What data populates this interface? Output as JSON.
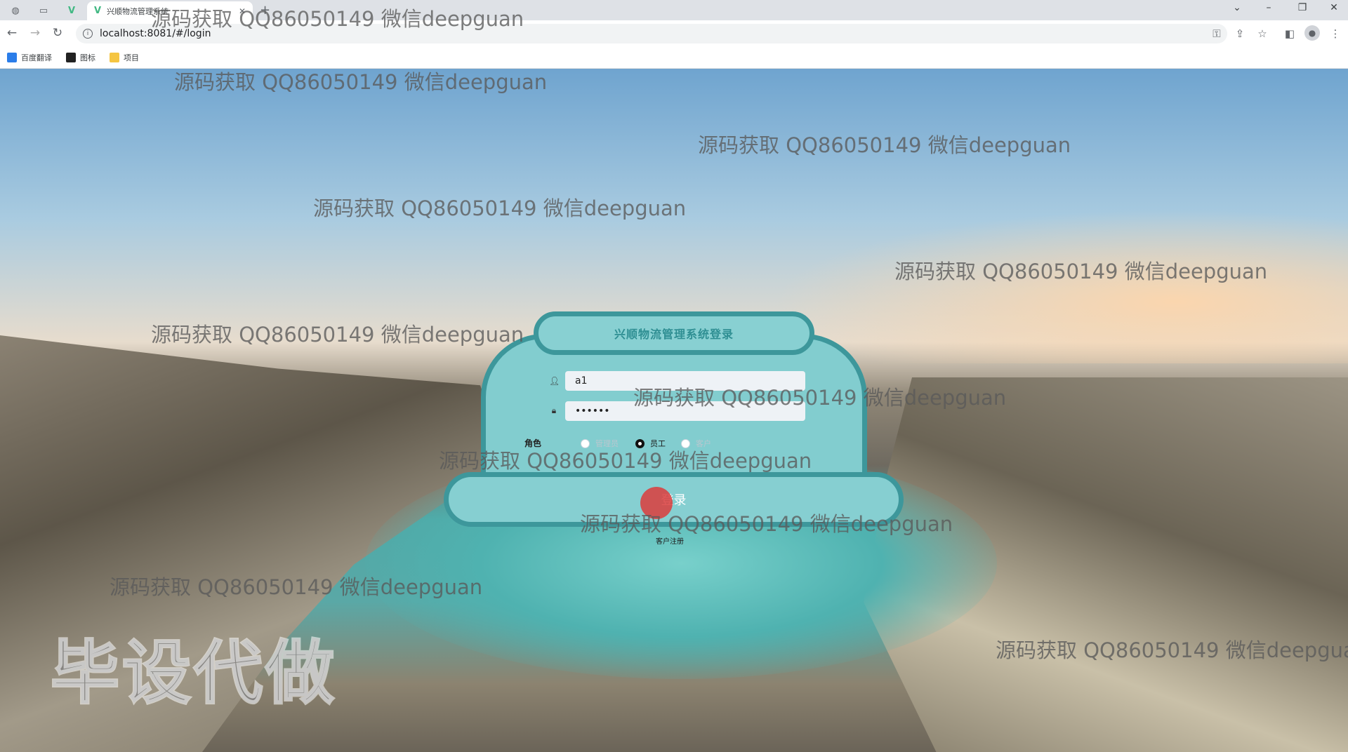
{
  "browser": {
    "tab_title": "兴顺物流管理系统",
    "url": "localhost:8081/#/login",
    "bookmarks": [
      {
        "label": "百度翻译",
        "icon": "translate-icon",
        "color": "#2b7de9"
      },
      {
        "label": "图标",
        "icon": "image-icon",
        "color": "#222222"
      },
      {
        "label": "项目",
        "icon": "folder-icon",
        "color": "#f5c542"
      }
    ]
  },
  "login": {
    "title": "兴顺物流管理系统登录",
    "username": "a1",
    "password": "••••••",
    "role_label": "角色",
    "roles": [
      "管理员",
      "员工",
      "客户"
    ],
    "selected_role": "员工",
    "login_button": "登录",
    "register_link": "客户注册"
  },
  "watermark": {
    "text": "源码获取 QQ86050149 微信deepguan",
    "big_text": "毕设代做"
  },
  "colors": {
    "card_fill": "#82cdcf",
    "card_border": "#3d979b",
    "title_color": "#2f8f93"
  }
}
